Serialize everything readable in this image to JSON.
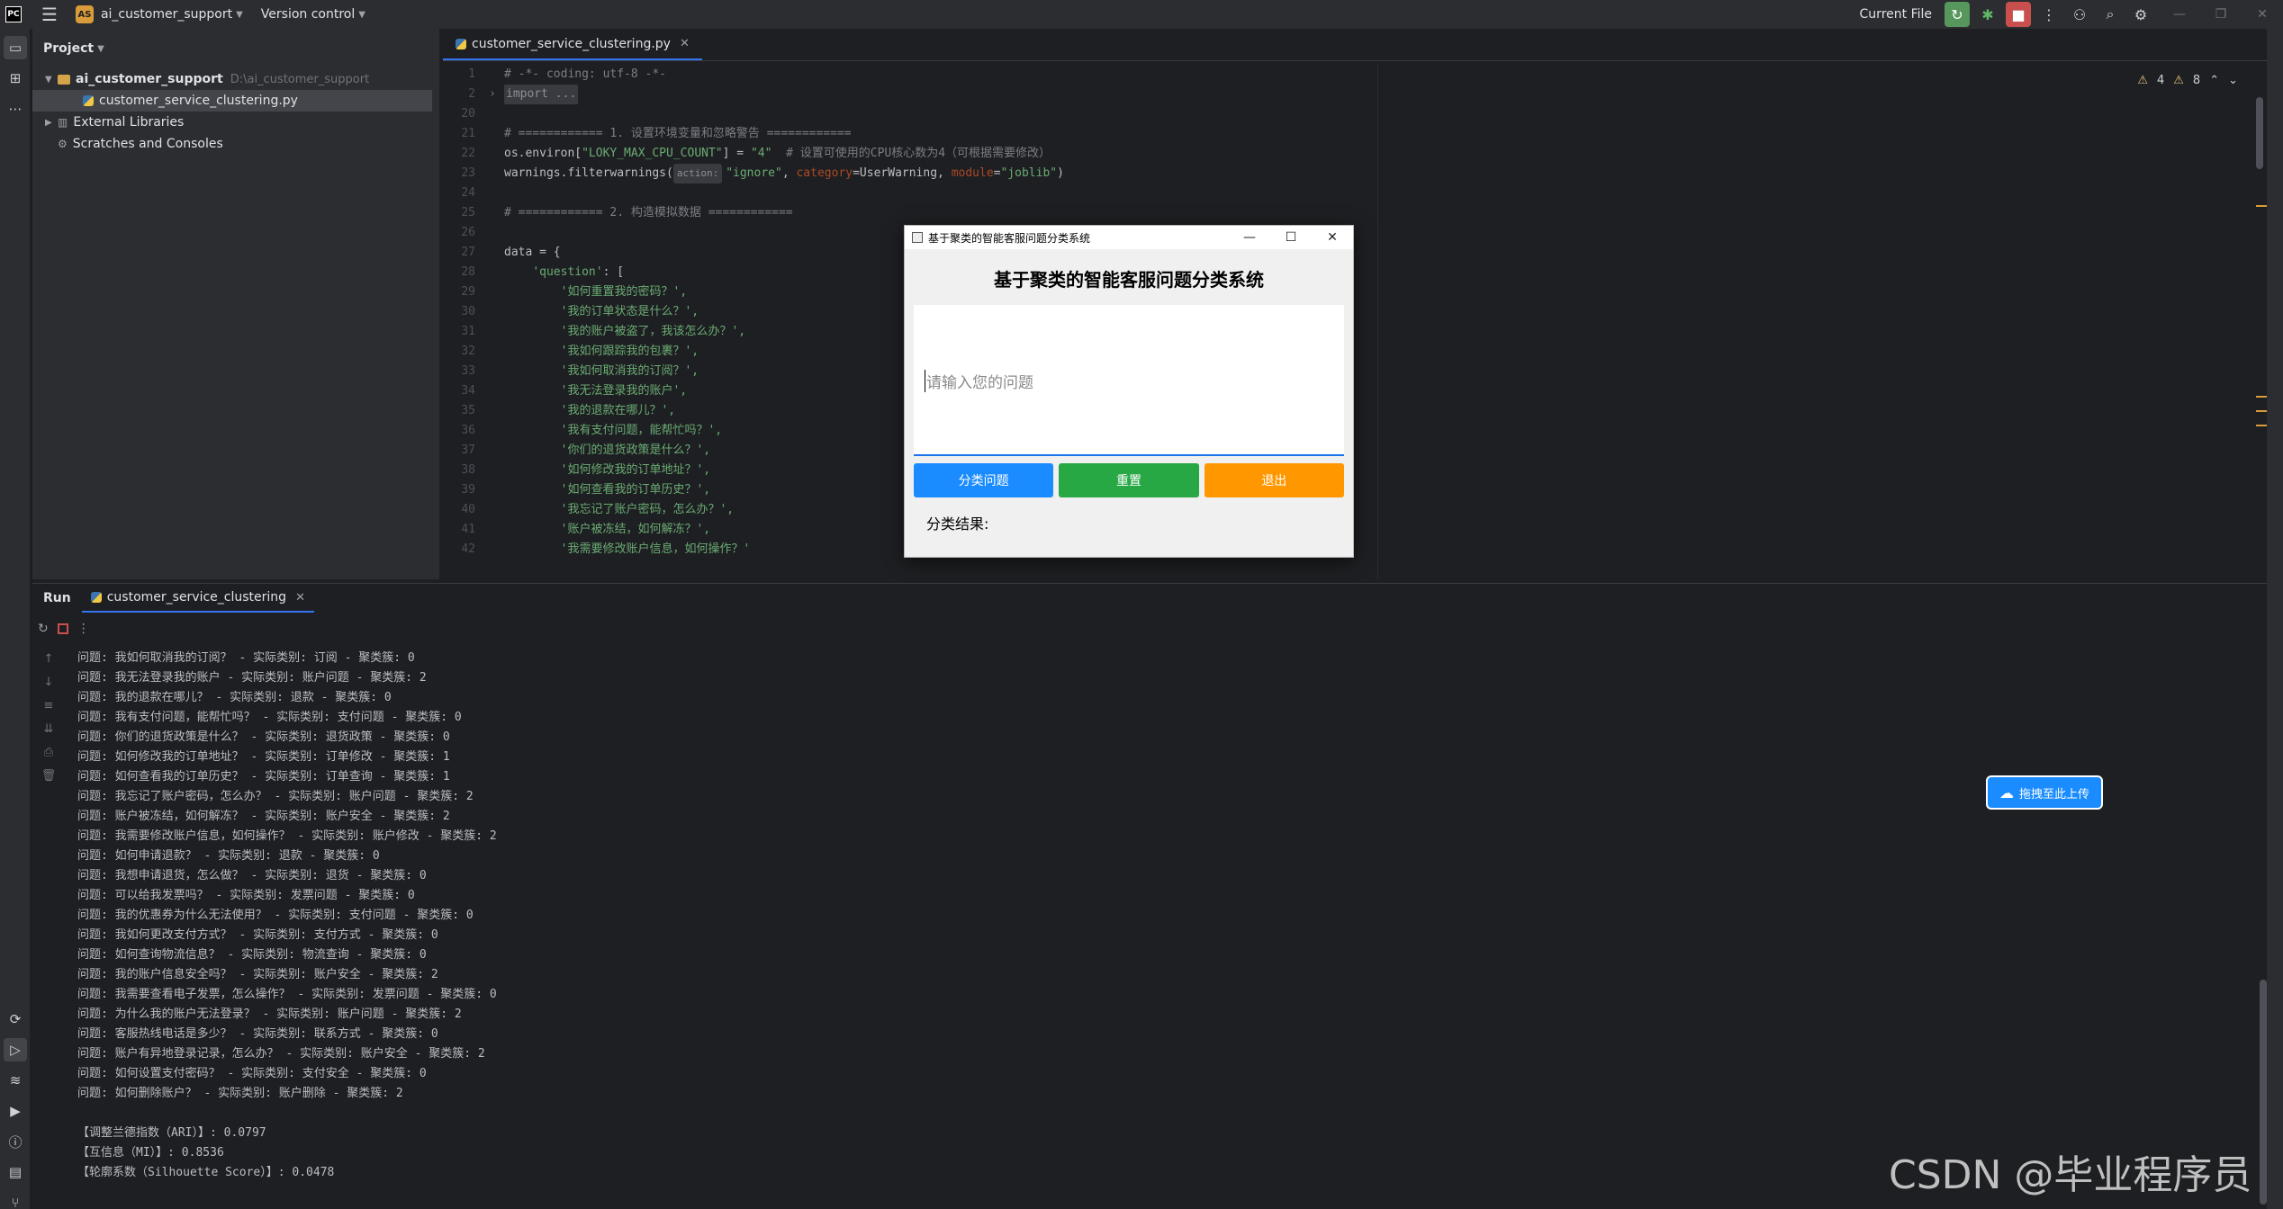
{
  "titlebar": {
    "logo": "PC",
    "project_badge": "AS",
    "project_name": "ai_customer_support",
    "version_control": "Version control",
    "current_file": "Current File"
  },
  "project_panel": {
    "title": "Project",
    "root_name": "ai_customer_support",
    "root_path": "D:\\ai_customer_support",
    "file": "customer_service_clustering.py",
    "external_libraries": "External Libraries",
    "scratches": "Scratches and Consoles"
  },
  "editor": {
    "tab": "customer_service_clustering.py",
    "warnings_a": "4",
    "warnings_b": "8",
    "lines": {
      "l1_num": "1",
      "l1": "# -*- coding: utf-8 -*-",
      "l2_num": "2",
      "l2": "import ...",
      "l20_num": "20",
      "l21_num": "21",
      "l21": "# ============ 1. 设置环境变量和忽略警告 ============",
      "l22_num": "22",
      "l22_a": "os.environ[",
      "l22_b": "\"LOKY_MAX_CPU_COUNT\"",
      "l22_c": "] = ",
      "l22_d": "\"4\"",
      "l22_e": "  # 设置可使用的CPU核心数为4（可根据需要修改）",
      "l23_num": "23",
      "l23_a": "warnings.filterwarnings(",
      "l23_hint": "action:",
      "l23_b": "\"ignore\"",
      "l23_c": ", ",
      "l23_d": "category",
      "l23_e": "=UserWarning, ",
      "l23_f": "module",
      "l23_g": "=",
      "l23_h": "\"joblib\"",
      "l23_i": ")",
      "l24_num": "24",
      "l25_num": "25",
      "l25": "# ============ 2. 构造模拟数据 ============",
      "l26_num": "26",
      "l27_num": "27",
      "l27": "data = {",
      "l28_num": "28",
      "l28_a": "    ",
      "l28_b": "'question'",
      "l28_c": ": [",
      "l29_num": "29",
      "l29": "        '如何重置我的密码？',",
      "l30_num": "30",
      "l30": "        '我的订单状态是什么？',",
      "l31_num": "31",
      "l31": "        '我的账户被盗了，我该怎么办？',",
      "l32_num": "32",
      "l32": "        '我如何跟踪我的包裹？',",
      "l33_num": "33",
      "l33": "        '我如何取消我的订阅？',",
      "l34_num": "34",
      "l34": "        '我无法登录我的账户',",
      "l35_num": "35",
      "l35": "        '我的退款在哪儿？',",
      "l36_num": "36",
      "l36": "        '我有支付问题，能帮忙吗？',",
      "l37_num": "37",
      "l37": "        '你们的退货政策是什么？',",
      "l38_num": "38",
      "l38": "        '如何修改我的订单地址？',",
      "l39_num": "39",
      "l39": "        '如何查看我的订单历史？',",
      "l40_num": "40",
      "l40": "        '我忘记了账户密码，怎么办？',",
      "l41_num": "41",
      "l41": "        '账户被冻结，如何解冻？',",
      "l42_num": "42",
      "l42": "        '我需要修改账户信息，如何操作？'"
    }
  },
  "run_panel": {
    "title": "Run",
    "tab": "customer_service_clustering",
    "console": [
      "问题: 我如何取消我的订阅？ - 实际类别: 订阅 - 聚类簇: 0",
      "问题: 我无法登录我的账户 - 实际类别: 账户问题 - 聚类簇: 2",
      "问题: 我的退款在哪儿？ - 实际类别: 退款 - 聚类簇: 0",
      "问题: 我有支付问题，能帮忙吗？ - 实际类别: 支付问题 - 聚类簇: 0",
      "问题: 你们的退货政策是什么？ - 实际类别: 退货政策 - 聚类簇: 0",
      "问题: 如何修改我的订单地址？ - 实际类别: 订单修改 - 聚类簇: 1",
      "问题: 如何查看我的订单历史？ - 实际类别: 订单查询 - 聚类簇: 1",
      "问题: 我忘记了账户密码，怎么办？ - 实际类别: 账户问题 - 聚类簇: 2",
      "问题: 账户被冻结，如何解冻？ - 实际类别: 账户安全 - 聚类簇: 2",
      "问题: 我需要修改账户信息，如何操作？ - 实际类别: 账户修改 - 聚类簇: 2",
      "问题: 如何申请退款？ - 实际类别: 退款 - 聚类簇: 0",
      "问题: 我想申请退货，怎么做？ - 实际类别: 退货 - 聚类簇: 0",
      "问题: 可以给我发票吗？ - 实际类别: 发票问题 - 聚类簇: 0",
      "问题: 我的优惠券为什么无法使用？ - 实际类别: 支付问题 - 聚类簇: 0",
      "问题: 我如何更改支付方式？ - 实际类别: 支付方式 - 聚类簇: 0",
      "问题: 如何查询物流信息？ - 实际类别: 物流查询 - 聚类簇: 0",
      "问题: 我的账户信息安全吗？ - 实际类别: 账户安全 - 聚类簇: 2",
      "问题: 我需要查看电子发票，怎么操作？ - 实际类别: 发票问题 - 聚类簇: 0",
      "问题: 为什么我的账户无法登录？ - 实际类别: 账户问题 - 聚类簇: 2",
      "问题: 客服热线电话是多少？ - 实际类别: 联系方式 - 聚类簇: 0",
      "问题: 账户有异地登录记录，怎么办？ - 实际类别: 账户安全 - 聚类簇: 2",
      "问题: 如何设置支付密码？ - 实际类别: 支付安全 - 聚类簇: 0",
      "问题: 如何删除账户？ - 实际类别: 账户删除 - 聚类簇: 2",
      "",
      "【调整兰德指数（ARI）】: 0.0797",
      "【互信息（MI）】: 0.8536",
      "【轮廓系数（Silhouette Score）】: 0.0478"
    ]
  },
  "upload": {
    "label": "拖拽至此上传"
  },
  "watermark": "CSDN @毕业程序员",
  "dialog": {
    "window_title": "基于聚类的智能客服问题分类系统",
    "heading": "基于聚类的智能客服问题分类系统",
    "placeholder": "请输入您的问题",
    "classify": "分类问题",
    "reset": "重置",
    "exit": "退出",
    "result_label": "分类结果:"
  },
  "colors": {
    "accent": "#3574f0",
    "btn_blue": "#1a8cff",
    "btn_green": "#28a745",
    "btn_orange": "#ff9800"
  }
}
